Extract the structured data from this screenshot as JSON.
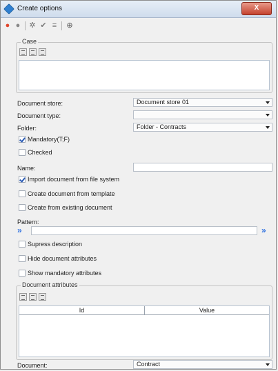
{
  "window": {
    "title": "Create options",
    "close_label": "X"
  },
  "toolbar": {
    "icons": [
      "new-red-icon",
      "record-icon",
      "settings-icon",
      "check-icon",
      "align-icon",
      "add-doc-icon"
    ]
  },
  "case_group": {
    "label": "Case"
  },
  "fields": {
    "document_store_label": "Document store:",
    "document_store_value": "Document store 01",
    "document_type_label": "Document type:",
    "document_type_value": "",
    "folder_label": "Folder:",
    "folder_value": "Folder - Contracts",
    "mandatory_label": "Mandatory(T;F)",
    "mandatory_checked": true,
    "checked_label": "Checked",
    "checked_checked": false,
    "name_label": "Name:",
    "name_value": "",
    "import_label": "Import document from file system",
    "import_checked": true,
    "create_template_label": "Create document from template",
    "create_template_checked": false,
    "create_existing_label": "Create from existing document",
    "create_existing_checked": false,
    "pattern_label": "Pattern:",
    "pattern_value": "",
    "supress_label": "Supress description",
    "hide_attrs_label": "Hide document attributes",
    "show_mandatory_label": "Show mandatory attributes",
    "document_label": "Document:",
    "document_value": "Contract"
  },
  "attributes_group": {
    "label": "Document attributes",
    "columns": [
      "Id",
      "Value"
    ]
  }
}
